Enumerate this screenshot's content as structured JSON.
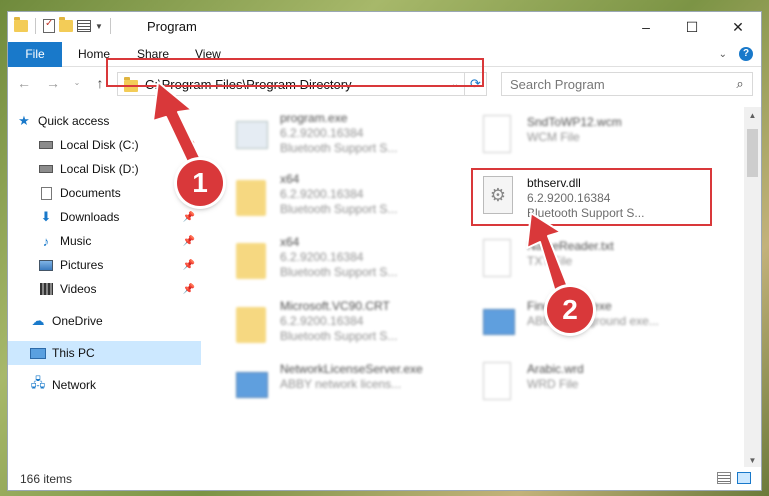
{
  "window": {
    "title": "Program",
    "controls": {
      "minimize": "–",
      "maximize": "☐",
      "close": "✕"
    }
  },
  "ribbon": {
    "tabs": [
      "File",
      "Home",
      "Share",
      "View"
    ],
    "help": "?"
  },
  "address": {
    "path": "C:\\Program Files\\Program Directory",
    "search_placeholder": "Search Program"
  },
  "sidebar": {
    "items": [
      {
        "label": "Quick access",
        "icon": "star-icon",
        "pinned": false
      },
      {
        "label": "Local Disk (C:)",
        "icon": "drive-icon",
        "pinned": true
      },
      {
        "label": "Local Disk (D:)",
        "icon": "drive-icon",
        "pinned": false
      },
      {
        "label": "Documents",
        "icon": "documents-icon",
        "pinned": true
      },
      {
        "label": "Downloads",
        "icon": "download-icon",
        "pinned": true
      },
      {
        "label": "Music",
        "icon": "music-icon",
        "pinned": true
      },
      {
        "label": "Pictures",
        "icon": "pictures-icon",
        "pinned": true
      },
      {
        "label": "Videos",
        "icon": "videos-icon",
        "pinned": true
      },
      {
        "label": "OneDrive",
        "icon": "cloud-icon",
        "pinned": false
      },
      {
        "label": "This PC",
        "icon": "computer-icon",
        "pinned": false,
        "selected": true
      },
      {
        "label": "Network",
        "icon": "network-icon",
        "pinned": false
      }
    ]
  },
  "files": {
    "left": [
      {
        "name": "program.exe",
        "line2": "6.2.9200.16384",
        "line3": "Bluetooth Support S...",
        "icon": "exe-icon"
      },
      {
        "name": "x64",
        "line2": "6.2.9200.16384",
        "line3": "Bluetooth Support S...",
        "icon": "folder-icon"
      },
      {
        "name": "x64",
        "line2": "6.2.9200.16384",
        "line3": "Bluetooth Support S...",
        "icon": "folder-icon"
      },
      {
        "name": "Microsoft.VC90.CRT",
        "line2": "6.2.9200.16384",
        "line3": "Bluetooth Support S...",
        "icon": "folder-icon"
      },
      {
        "name": "NetworkLicenseServer.exe",
        "line2": "ABBY network licens...",
        "line3": "",
        "icon": "exe-icon"
      }
    ],
    "right": [
      {
        "name": "SndToWP12.wcm",
        "line2": "WCM File",
        "line3": "",
        "icon": "document-icon"
      },
      {
        "name": "bthserv.dll",
        "line2": "6.2.9200.16384",
        "line3": "Bluetooth Support S...",
        "icon": "dll-icon",
        "highlighted": true
      },
      {
        "name": "NameReader.txt",
        "line2": "TXT File",
        "line3": "",
        "icon": "document-icon"
      },
      {
        "name": "FineReader.exe",
        "line2": "ABBY Background exe...",
        "line3": "",
        "icon": "exe-icon"
      },
      {
        "name": "Arabic.wrd",
        "line2": "WRD File",
        "line3": "",
        "icon": "document-icon"
      }
    ]
  },
  "status": {
    "item_count": "166 items"
  },
  "callouts": [
    "1",
    "2"
  ],
  "colors": {
    "accent": "#1979ca",
    "highlight_red": "#d9383a",
    "selected_bg": "#cce8ff"
  }
}
